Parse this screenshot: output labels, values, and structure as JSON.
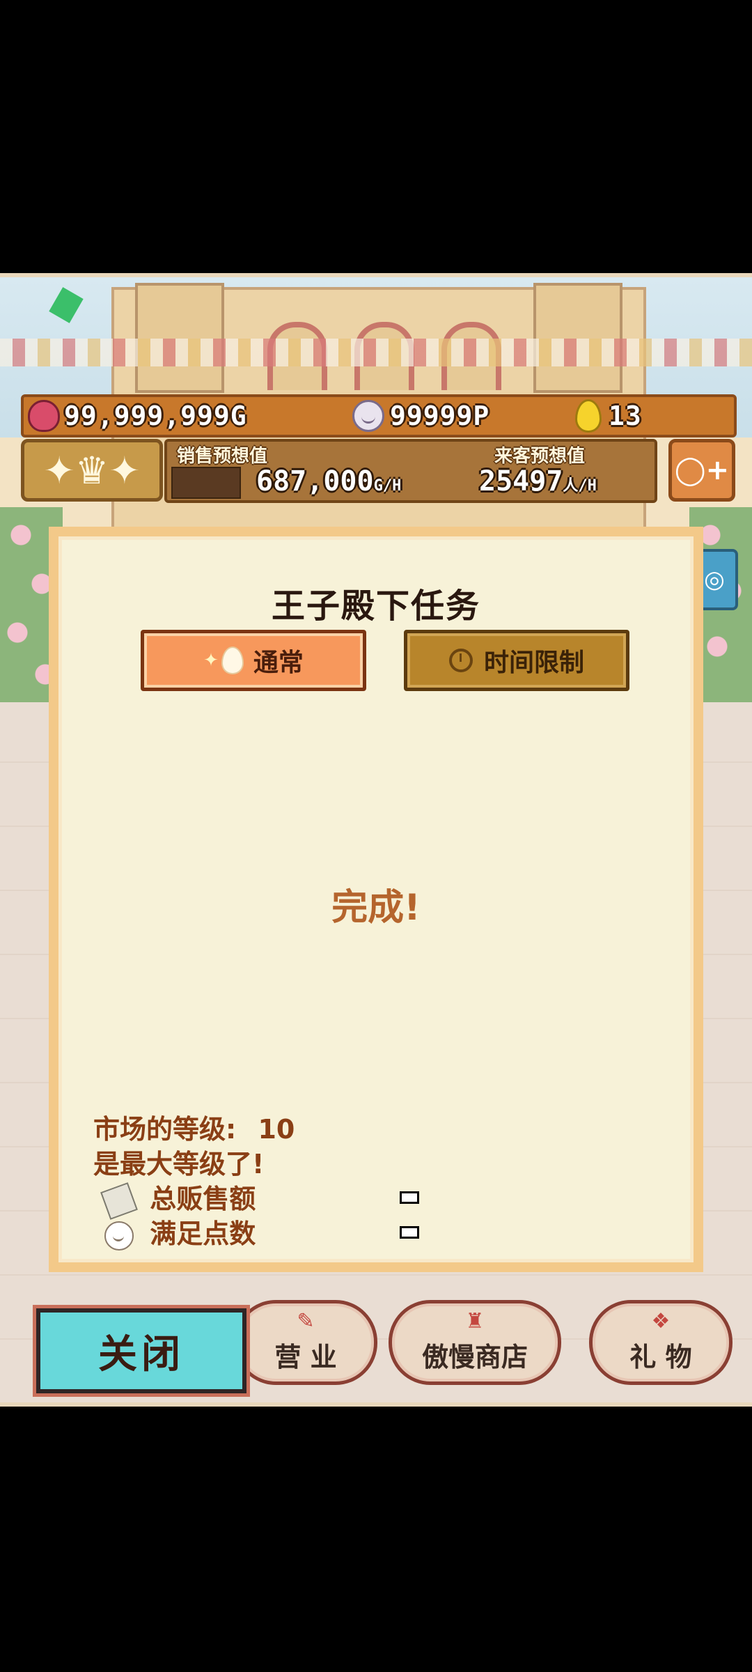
{
  "hud": {
    "gold": "99,999,999G",
    "points": "99999P",
    "eggs": "13",
    "sales_label": "销售预想值",
    "sales_value": "687,000",
    "sales_unit": "G/H",
    "visitors_label": "来客预想值",
    "visitors_value": "25497",
    "visitors_unit": "人/H"
  },
  "dialog": {
    "title": "王子殿下任务",
    "tab_normal": "通常",
    "tab_timed": "时间限制",
    "status": "完成!",
    "market_level_label": "市场的等级:",
    "market_level_value": "10",
    "max_level_note": "是最大等级了!",
    "total_sales_label": "总贩售额",
    "satisfaction_label": "满足点数"
  },
  "nav": {
    "close_label": "关闭",
    "business_label": "营 业",
    "shop_label": "傲慢商店",
    "gift_label": "礼 物"
  }
}
